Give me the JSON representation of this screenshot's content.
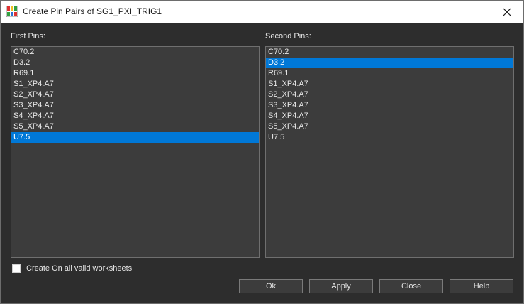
{
  "window": {
    "title": "Create Pin Pairs of SG1_PXI_TRIG1",
    "close_glyph": "✕",
    "icon": "app-icon"
  },
  "first_pins": {
    "label": "First Pins:",
    "items": [
      "C70.2",
      "D3.2",
      "R69.1",
      "S1_XP4.A7",
      "S2_XP4.A7",
      "S3_XP4.A7",
      "S4_XP4.A7",
      "S5_XP4.A7",
      "U7.5"
    ],
    "selected": "U7.5"
  },
  "second_pins": {
    "label": "Second Pins:",
    "items": [
      "C70.2",
      "D3.2",
      "R69.1",
      "S1_XP4.A7",
      "S2_XP4.A7",
      "S3_XP4.A7",
      "S4_XP4.A7",
      "S5_XP4.A7",
      "U7.5"
    ],
    "selected": "D3.2"
  },
  "option": {
    "label": "Create On all valid worksheets",
    "checked": false
  },
  "buttons": {
    "ok": "Ok",
    "apply": "Apply",
    "close": "Close",
    "help": "Help"
  },
  "colors": {
    "selection": "#0078d7",
    "background": "#2d2d2d",
    "list_background": "#3c3c3c"
  }
}
